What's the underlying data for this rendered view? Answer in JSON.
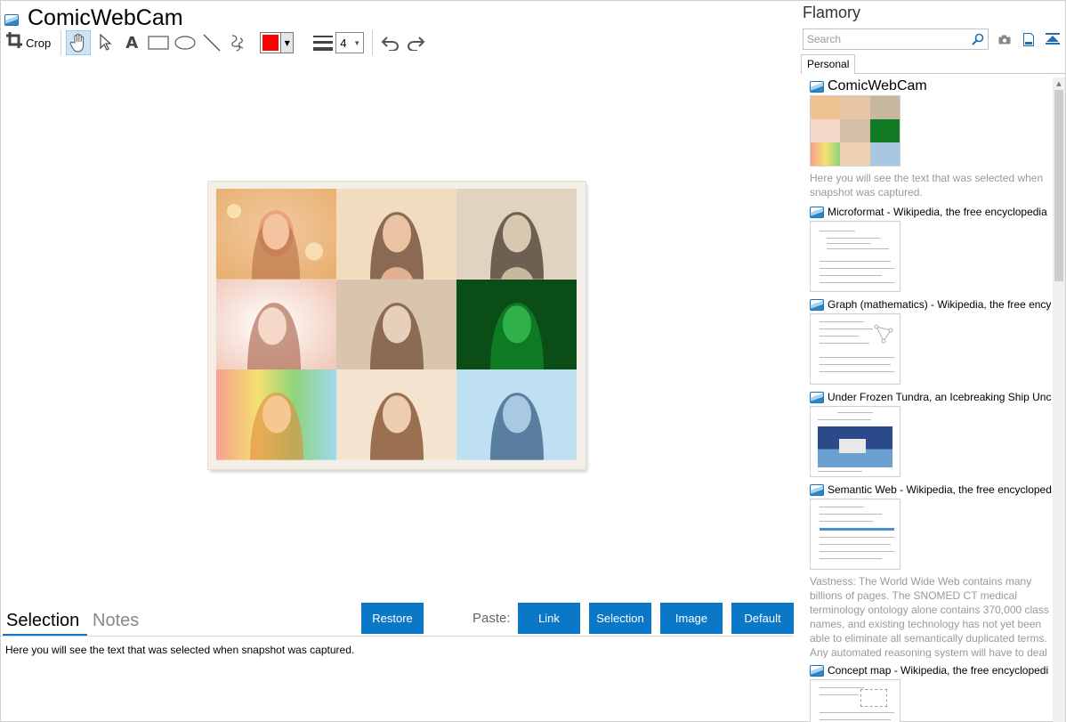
{
  "document": {
    "title": "ComicWebCam"
  },
  "toolbar": {
    "crop_label": "Crop",
    "line_width": "4",
    "pen_color": "#ff0000",
    "tools": [
      "hand-icon",
      "pointer-icon",
      "text-icon",
      "rectangle-icon",
      "ellipse-icon",
      "line-icon",
      "freehand-icon"
    ]
  },
  "bottom": {
    "tabs": [
      {
        "label": "Selection",
        "active": true
      },
      {
        "label": "Notes",
        "active": false
      }
    ],
    "restore_label": "Restore",
    "paste_label": "Paste:",
    "paste_buttons": [
      "Link",
      "Selection",
      "Image",
      "Default"
    ],
    "selection_text": "Here you will see the text that was selected when snapshot was captured."
  },
  "sidebar": {
    "title": "Flamory",
    "search_placeholder": "Search",
    "tab_label": "Personal",
    "snapshots": [
      {
        "title": "ComicWebCam",
        "description": "Here you will see the text that was selected when snapshot was captured."
      },
      {
        "title": "Microformat - Wikipedia, the free encyclopedia",
        "description": ""
      },
      {
        "title": "Graph (mathematics) - Wikipedia, the free ency",
        "description": ""
      },
      {
        "title": "Under Frozen Tundra, an Icebreaking Ship Unco",
        "description": ""
      },
      {
        "title": "Semantic Web - Wikipedia, the free encycloped",
        "description": "Vastness: The World Wide Web contains many billions of pages. The SNOMED CT medical terminology ontology alone contains 370,000 class names, and existing technology has not yet been able to eliminate all semantically duplicated terms. Any automated reasoning system will have to deal with truly huge inputs."
      },
      {
        "title": "Concept map - Wikipedia, the free encyclopedi",
        "description": ""
      }
    ]
  },
  "colors": {
    "accent": "#0a77c7",
    "tab_underline": "#1a73c0"
  }
}
